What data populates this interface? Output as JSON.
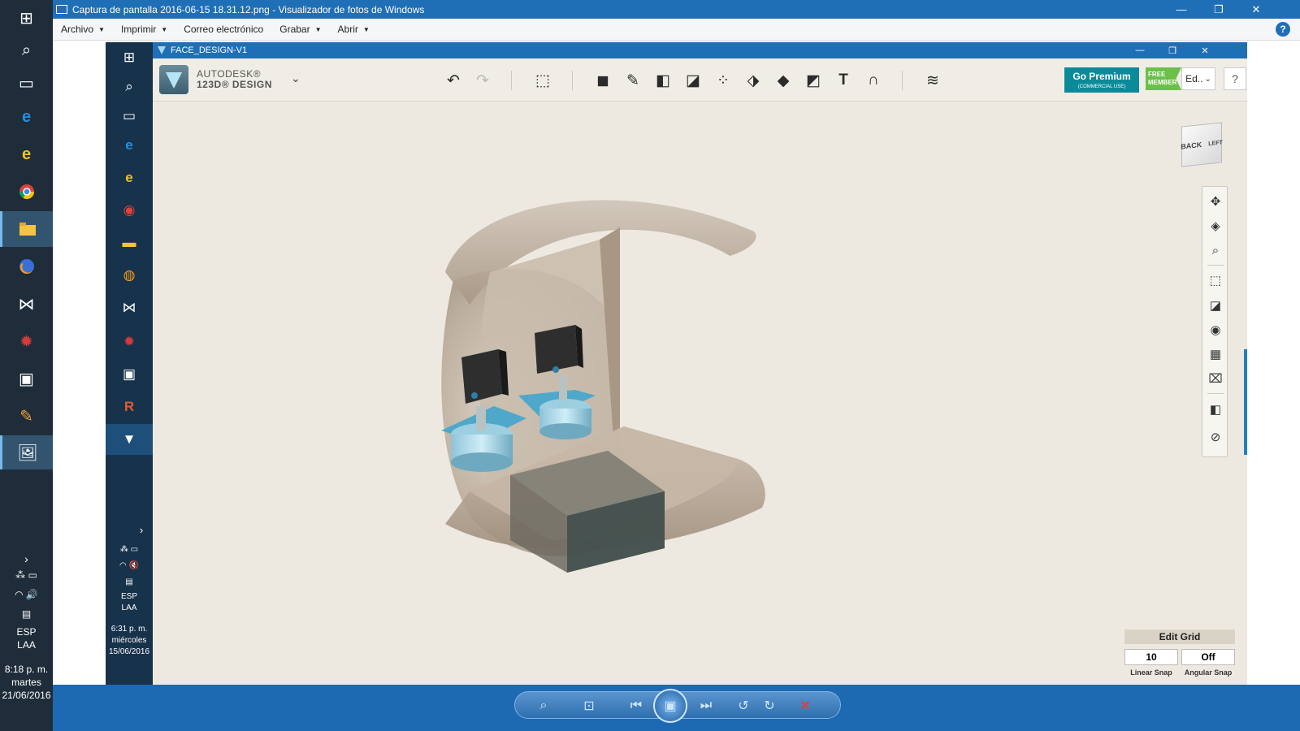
{
  "viewer": {
    "title": "Captura de pantalla 2016-06-15 18.31.12.png - Visualizador de fotos de Windows",
    "menu": [
      "Archivo",
      "Imprimir",
      "Correo electrónico",
      "Grabar",
      "Abrir"
    ],
    "help": "?"
  },
  "outer_taskbar": {
    "language": "ESP",
    "layout": "LAA",
    "time": "8:18 p. m.",
    "day": "martes",
    "date": "21/06/2016"
  },
  "inner_taskbar": {
    "language": "ESP",
    "layout": "LAA",
    "time": "6:31 p. m.",
    "day": "miércoles",
    "date": "15/06/2016"
  },
  "app": {
    "window_title": "FACE_DESIGN-V1",
    "brand_line1": "AUTODESK®",
    "brand_line2": "123D® DESIGN",
    "premium_label": "Go Premium",
    "premium_sub": "(COMMERCIAL USE)",
    "free_line1": "FREE",
    "free_line2": "MEMBER",
    "user_dropdown": "Ed..",
    "help": "?"
  },
  "viewcube": {
    "back": "BACK",
    "left": "LEFT"
  },
  "grid": {
    "title": "Edit Grid",
    "linear_snap_value": "10",
    "angular_snap_value": "Off",
    "linear_snap_label": "Linear Snap",
    "angular_snap_label": "Angular Snap"
  },
  "colors": {
    "accent": "#1f6fb7",
    "premium": "#0b8a9a",
    "free": "#6cc04a",
    "viewport": "#eee9e0"
  }
}
